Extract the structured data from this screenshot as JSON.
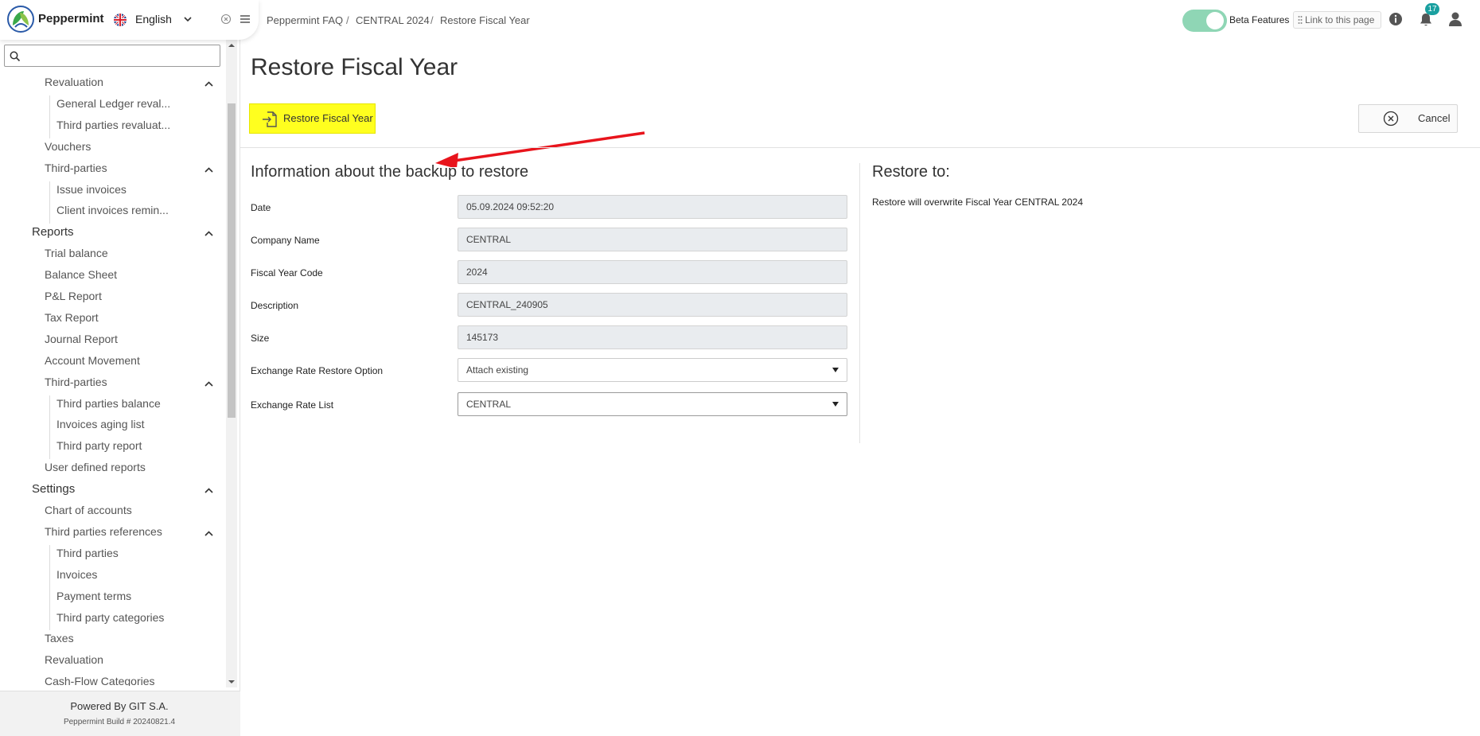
{
  "app": {
    "brand": "Peppermint",
    "language": "English"
  },
  "sidebar": {
    "search_placeholder": "",
    "items": [
      {
        "label": "Revaluation",
        "level": 1,
        "chevron": true
      },
      {
        "label": "General Ledger reval...",
        "level": 2
      },
      {
        "label": "Third parties revaluat...",
        "level": 2
      },
      {
        "label": "Vouchers",
        "level": 1
      },
      {
        "label": "Third-parties",
        "level": 1,
        "chevron": true
      },
      {
        "label": "Issue invoices",
        "level": 2
      },
      {
        "label": "Client invoices remin...",
        "level": 2
      },
      {
        "label": "Reports",
        "level": 0,
        "chevron": true
      },
      {
        "label": "Trial balance",
        "level": 1
      },
      {
        "label": "Balance Sheet",
        "level": 1
      },
      {
        "label": "P&L Report",
        "level": 1
      },
      {
        "label": "Tax Report",
        "level": 1
      },
      {
        "label": "Journal Report",
        "level": 1
      },
      {
        "label": "Account Movement",
        "level": 1
      },
      {
        "label": "Third-parties",
        "level": 1,
        "chevron": true
      },
      {
        "label": "Third parties balance",
        "level": 2
      },
      {
        "label": "Invoices aging list",
        "level": 2
      },
      {
        "label": "Third party report",
        "level": 2
      },
      {
        "label": "User defined reports",
        "level": 1
      },
      {
        "label": "Settings",
        "level": 0,
        "chevron": true
      },
      {
        "label": "Chart of accounts",
        "level": 1
      },
      {
        "label": "Third parties references",
        "level": 1,
        "chevron": true
      },
      {
        "label": "Third parties",
        "level": 2
      },
      {
        "label": "Invoices",
        "level": 2
      },
      {
        "label": "Payment terms",
        "level": 2
      },
      {
        "label": "Third party categories",
        "level": 2
      },
      {
        "label": "Taxes",
        "level": 1
      },
      {
        "label": "Revaluation",
        "level": 1
      },
      {
        "label": "Cash-Flow Categories",
        "level": 1
      }
    ],
    "footer": {
      "powered": "Powered By GIT S.A.",
      "build": "Peppermint Build # 20240821.4"
    }
  },
  "header": {
    "breadcrumb": [
      "Peppermint FAQ",
      "CENTRAL 2024",
      "Restore Fiscal Year"
    ],
    "beta_label": "Beta Features",
    "beta_enabled": true,
    "link_label": "Link to this page",
    "notification_count": "17"
  },
  "page": {
    "title": "Restore Fiscal Year",
    "restore_button": "Restore Fiscal Year",
    "cancel_button": "Cancel",
    "section_title": "Information about the backup to restore",
    "fields": [
      {
        "label": "Date",
        "value": "05.09.2024 09:52:20",
        "type": "readonly"
      },
      {
        "label": "Company Name",
        "value": "CENTRAL",
        "type": "readonly"
      },
      {
        "label": "Fiscal Year Code",
        "value": "2024",
        "type": "readonly"
      },
      {
        "label": "Description",
        "value": "CENTRAL_240905",
        "type": "readonly"
      },
      {
        "label": "Size",
        "value": "145173",
        "type": "readonly"
      },
      {
        "label": "Exchange Rate Restore Option",
        "value": "Attach existing",
        "type": "select"
      },
      {
        "label": "Exchange Rate List",
        "value": "CENTRAL",
        "type": "select"
      }
    ],
    "restore_to_title": "Restore to:",
    "restore_to_message": "Restore will overwrite Fiscal Year CENTRAL 2024"
  },
  "colors": {
    "highlight": "#ffff1f",
    "annotation_arrow": "#e8141c",
    "toggle": "#8fd6b5",
    "badge": "#1aa0a0"
  }
}
